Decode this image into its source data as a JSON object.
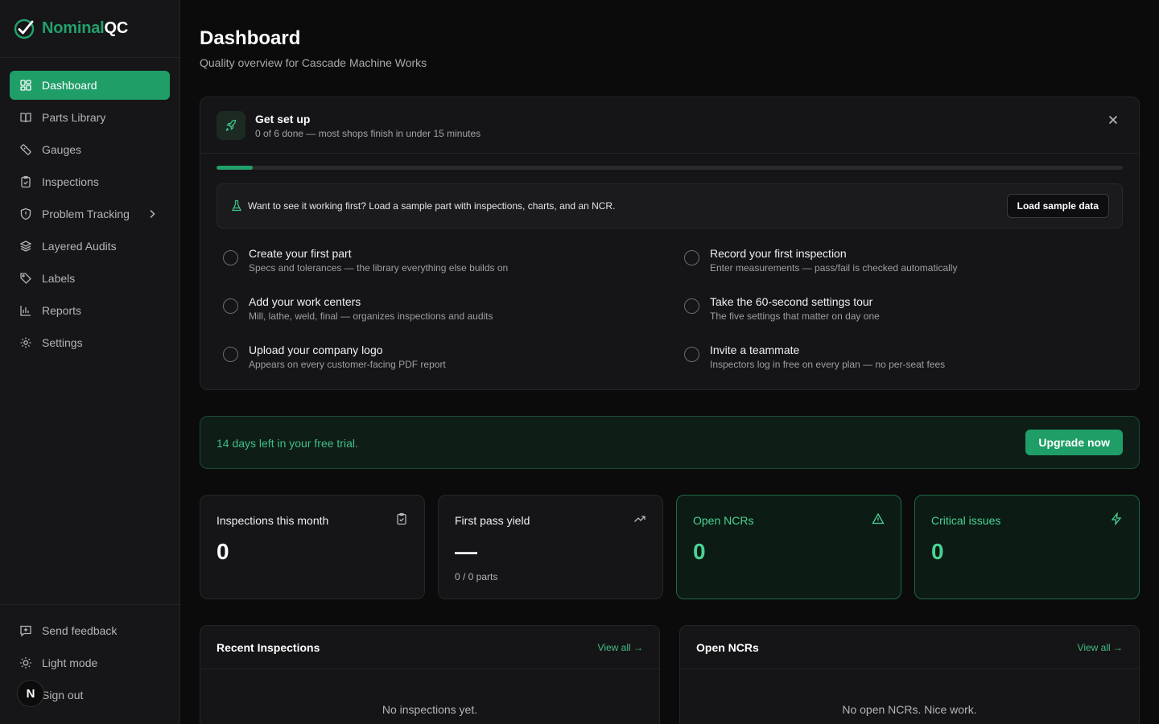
{
  "brand": {
    "name_a": "Nominal",
    "name_b": "QC",
    "accent": "#22a06b"
  },
  "sidebar": {
    "items": [
      {
        "label": "Dashboard",
        "icon": "dashboard-grid-icon",
        "active": true
      },
      {
        "label": "Parts Library",
        "icon": "book-icon"
      },
      {
        "label": "Gauges",
        "icon": "ruler-icon"
      },
      {
        "label": "Inspections",
        "icon": "clipboard-check-icon"
      },
      {
        "label": "Problem Tracking",
        "icon": "shield-icon",
        "has_submenu": true
      },
      {
        "label": "Layered Audits",
        "icon": "layers-icon"
      },
      {
        "label": "Labels",
        "icon": "tag-icon"
      },
      {
        "label": "Reports",
        "icon": "bar-chart-icon"
      },
      {
        "label": "Settings",
        "icon": "gear-icon"
      }
    ],
    "bottom": [
      {
        "label": "Send feedback",
        "icon": "message-plus-icon"
      },
      {
        "label": "Light mode",
        "icon": "sun-icon"
      },
      {
        "label": "Sign out",
        "icon": "logout-icon"
      }
    ],
    "avatar_letter": "N"
  },
  "header": {
    "title": "Dashboard",
    "subtitle": "Quality overview for Cascade Machine Works"
  },
  "setup": {
    "title": "Get set up",
    "subtitle": "0 of 6 done — most shops finish in under 15 minutes",
    "progress_fraction": 0.04,
    "sample_text": "Want to see it working first? Load a sample part with inspections, charts, and an NCR.",
    "sample_button": "Load sample data",
    "tasks": [
      {
        "title": "Create your first part",
        "sub": "Specs and tolerances — the library everything else builds on"
      },
      {
        "title": "Record your first inspection",
        "sub": "Enter measurements — pass/fail is checked automatically"
      },
      {
        "title": "Add your work centers",
        "sub": "Mill, lathe, weld, final — organizes inspections and audits"
      },
      {
        "title": "Take the 60-second settings tour",
        "sub": "The five settings that matter on day one"
      },
      {
        "title": "Upload your company logo",
        "sub": "Appears on every customer-facing PDF report"
      },
      {
        "title": "Invite a teammate",
        "sub": "Inspectors log in free on every plan — no per-seat fees"
      }
    ]
  },
  "trial": {
    "text": "14 days left in your free trial.",
    "button": "Upgrade now"
  },
  "stats": [
    {
      "label": "Inspections this month",
      "value": "0",
      "note": "",
      "icon": "clipboard-check-icon"
    },
    {
      "label": "First pass yield",
      "value": "—",
      "note": "0 / 0 parts",
      "icon": "trending-up-icon"
    },
    {
      "label": "Open NCRs",
      "value": "0",
      "note": "",
      "icon": "warning-triangle-icon"
    },
    {
      "label": "Critical issues",
      "value": "0",
      "note": "",
      "icon": "lightning-icon"
    }
  ],
  "lists": [
    {
      "title": "Recent Inspections",
      "link": "View all →",
      "empty": "No inspections yet."
    },
    {
      "title": "Open NCRs",
      "link": "View all →",
      "empty": "No open NCRs. Nice work."
    }
  ]
}
